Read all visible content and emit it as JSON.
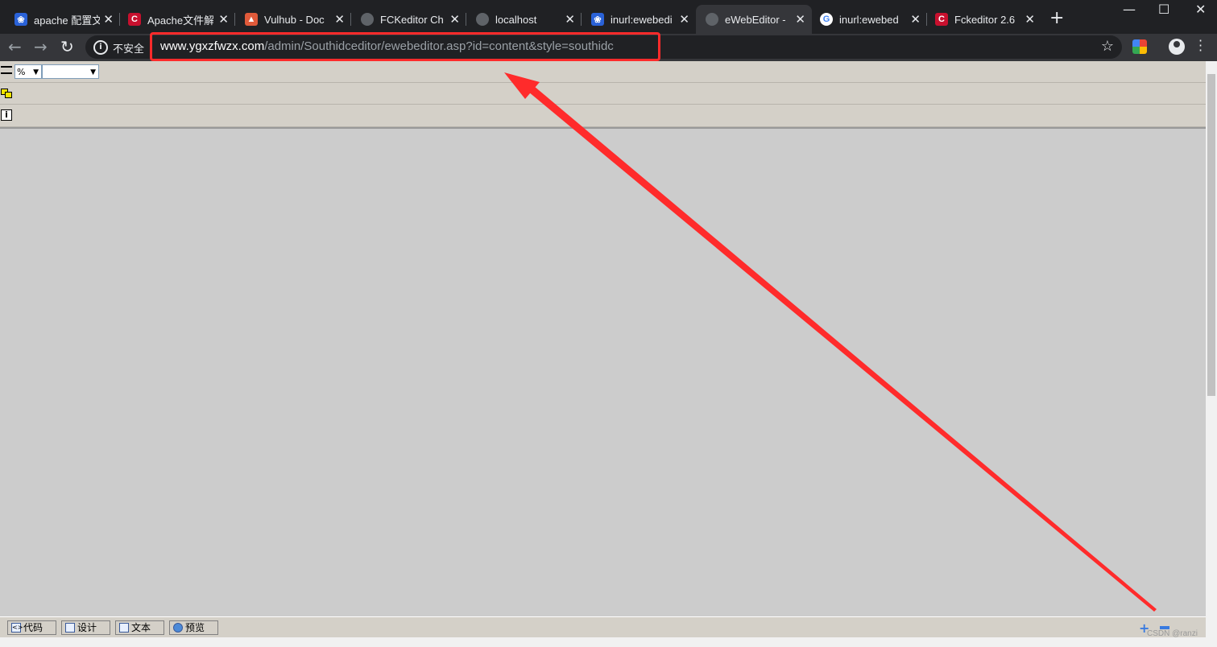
{
  "tabs": [
    {
      "title": "apache 配置文",
      "icon": "baidu-paw-icon",
      "color": "#2a62d8"
    },
    {
      "title": "Apache文件解",
      "icon": "csdn-c-icon",
      "color": "#c8102e"
    },
    {
      "title": "Vulhub - Doc",
      "icon": "vulhub-icon",
      "color": "#e05a3a"
    },
    {
      "title": "FCKeditor Ch",
      "icon": "globe-icon",
      "color": "#5f6368"
    },
    {
      "title": "localhost",
      "icon": "globe-icon",
      "color": "#5f6368"
    },
    {
      "title": "inurl:ewebedi",
      "icon": "baidu-paw-icon",
      "color": "#2a62d8"
    },
    {
      "title": "eWebEditor -",
      "icon": "globe-icon",
      "color": "#5f6368",
      "active": true
    },
    {
      "title": "inurl:ewebed",
      "icon": "google-g-icon",
      "color": "#ffffff"
    },
    {
      "title": "Fckeditor 2.6",
      "icon": "csdn-c-icon",
      "color": "#c8102e"
    }
  ],
  "omnibox": {
    "security_label": "不安全",
    "url_host": "www.ygxzfwzx.com",
    "url_path": "/admin/Southidceditor/ewebeditor.asp?id=content&style=southidc"
  },
  "editor": {
    "zoom_value": "%",
    "font_value": "",
    "modes": [
      {
        "label": "代码",
        "icon": "code-icon"
      },
      {
        "label": "设计",
        "icon": "design-icon"
      },
      {
        "label": "文本",
        "icon": "text-icon"
      },
      {
        "label": "预览",
        "icon": "preview-globe-icon"
      }
    ]
  },
  "watermark": "CSDN @ranzi",
  "colors": {
    "annotation": "#ff2b2b",
    "tabstrip": "#202124",
    "toolbar": "#35363a",
    "editor_bg": "#d4d0c8"
  }
}
